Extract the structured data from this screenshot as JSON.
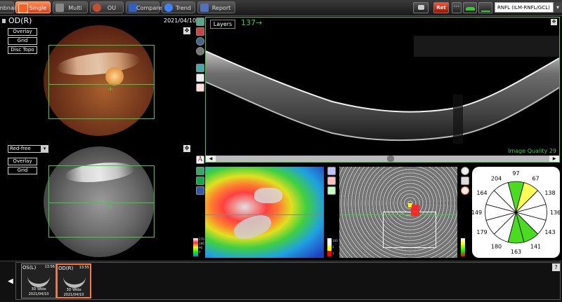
{
  "toolbar": {
    "tabs": [
      {
        "label": "mbnail",
        "icon": "thumbnail-icon",
        "active": false
      },
      {
        "label": "Single",
        "icon": "eye-icon",
        "active": true
      },
      {
        "label": "Multi",
        "icon": "multi-grid-icon",
        "active": false
      },
      {
        "label": "OU",
        "icon": "both-eyes-icon",
        "active": false
      },
      {
        "label": "Compare",
        "icon": "compare-icon",
        "active": false
      },
      {
        "label": "Trend",
        "icon": "trend-icon",
        "active": false
      },
      {
        "label": "Report",
        "icon": "report-icon",
        "active": false
      }
    ],
    "ret_label": "Ret",
    "layer_select": "RNFL (ILM-RNFL/GCL)"
  },
  "left": {
    "eye_label": "OD(R)",
    "date": "2021/04/10",
    "top_buttons": [
      "Overlay",
      "Grid",
      "Disc Topo"
    ],
    "redfree_select": "Red-free",
    "bottom_buttons": [
      "Overlay",
      "Grid"
    ],
    "side_tool_letter": "A"
  },
  "oct": {
    "layers_button": "Layers",
    "scan_number": "137→",
    "image_quality": "Image Quality 29"
  },
  "thickness_scale": {
    "labels": [
      "270",
      "180",
      "90",
      "0"
    ],
    "colors": [
      "#ffffff",
      "#ff3030",
      "#ffff00",
      "#00ff00",
      "#0080ff"
    ]
  },
  "deviation_scale": {
    "labels": [
      "100",
      "5",
      "1"
    ],
    "colors": [
      "#ffffff",
      "#ffff00",
      "#ff0000"
    ]
  },
  "clock_chart": {
    "labels": [
      "97",
      "67",
      "138",
      "136",
      "143",
      "141",
      "163",
      "180",
      "179",
      "149",
      "164",
      "204"
    ],
    "colors": [
      "#4bdc22",
      "#ffff55",
      "#ffffff",
      "#ffffff",
      "#ffffff",
      "#4bdc22",
      "#4bdc22",
      "#ffffff",
      "#ffffff",
      "#ffffff",
      "#ffffff",
      "#ffffff"
    ]
  },
  "thumbnails": [
    {
      "eye": "OS(L)",
      "time": "13:56",
      "type": "3D Wide",
      "date": "2021/04/10"
    },
    {
      "eye": "OD(R)",
      "time": "13:55",
      "type": "3D Wide",
      "date": "2021/04/10"
    }
  ],
  "help_label": "?"
}
